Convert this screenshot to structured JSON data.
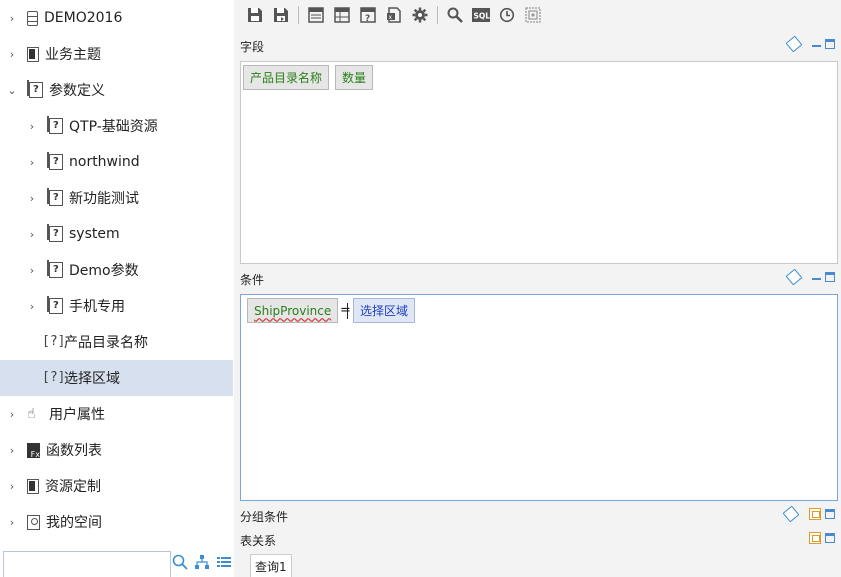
{
  "sidebar": {
    "items": [
      {
        "label": "DEMO2016",
        "icon": "database-icon",
        "chevron": "right"
      },
      {
        "label": "业务主题",
        "icon": "topic-icon",
        "chevron": "right"
      },
      {
        "label": "参数定义",
        "icon": "param-folder-icon",
        "chevron": "down"
      },
      {
        "label": "QTP-基础资源",
        "icon": "param-folder-icon",
        "chevron": "right"
      },
      {
        "label": "northwind",
        "icon": "param-folder-icon",
        "chevron": "right"
      },
      {
        "label": "新功能测试",
        "icon": "param-folder-icon",
        "chevron": "right"
      },
      {
        "label": "system",
        "icon": "param-folder-icon",
        "chevron": "right"
      },
      {
        "label": "Demo参数",
        "icon": "param-folder-icon",
        "chevron": "right"
      },
      {
        "label": "手机专用",
        "icon": "param-folder-icon",
        "chevron": "right"
      },
      {
        "label": "产品目录名称",
        "icon": "param-icon",
        "chevron": "none"
      },
      {
        "label": "选择区域",
        "icon": "param-icon",
        "chevron": "none",
        "selected": true
      },
      {
        "label": "用户属性",
        "icon": "hand-icon",
        "chevron": "right"
      },
      {
        "label": "函数列表",
        "icon": "function-icon",
        "chevron": "right"
      },
      {
        "label": "资源定制",
        "icon": "resource-icon",
        "chevron": "right"
      },
      {
        "label": "我的空间",
        "icon": "user-space-icon",
        "chevron": "right"
      }
    ],
    "search": {
      "value": "",
      "placeholder": ""
    }
  },
  "toolbar": {
    "buttons": [
      "save-icon",
      "save-as-icon",
      "layout-icon",
      "table-icon",
      "param-icon",
      "excel-icon",
      "settings-icon",
      "search-icon",
      "sql-icon",
      "history-icon",
      "clear-icon"
    ],
    "sql_label": "SQL"
  },
  "sections": {
    "fields": {
      "label": "字段",
      "chips": [
        "产品目录名称",
        "数量"
      ]
    },
    "conditions": {
      "label": "条件",
      "field": "ShipProvince",
      "operator": "=",
      "param": "选择区域"
    },
    "group_conditions": {
      "label": "分组条件"
    },
    "table_relations": {
      "label": "表关系"
    }
  },
  "tabs": [
    {
      "label": "查询1"
    }
  ],
  "colors": {
    "selected_row": "#d6e0ef",
    "field_text": "#2a7f1b",
    "param_text": "#2040c0",
    "panel_active_border": "#7aa7d8"
  }
}
